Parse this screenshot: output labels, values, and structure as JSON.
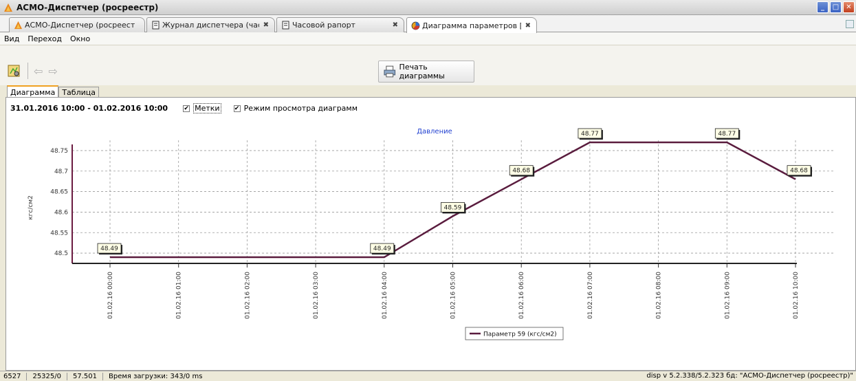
{
  "window": {
    "title": "АСМО-Диспетчер (росреестр)",
    "buttons": {
      "minimize": "_",
      "maximize": "□",
      "close": "✕"
    }
  },
  "tabs": [
    {
      "label": "АСМО-Диспетчер (росреест",
      "icon": "app-logo-icon",
      "closable": false
    },
    {
      "label": "Журнал диспетчера (час",
      "icon": "document-icon",
      "close": "✖"
    },
    {
      "label": "Часовой рапорт",
      "icon": "document-icon",
      "close": "✖"
    },
    {
      "label": "Диаграмма параметров [",
      "icon": "pie-chart-icon",
      "close": "✖",
      "active": true
    }
  ],
  "menu": [
    "Вид",
    "Переход",
    "Окно"
  ],
  "toolbar": {
    "print_label": "Печать диаграммы"
  },
  "view_tabs": [
    "Диаграмма",
    "Таблица"
  ],
  "range": "31.01.2016 10:00 - 01.02.2016 10:00",
  "checkboxes": [
    {
      "label": "Метки",
      "checked": true
    },
    {
      "label": "Режим просмотра диаграмм",
      "checked": true
    }
  ],
  "chart_data": {
    "type": "line",
    "title": "Давление",
    "ylabel": "кгс/см2",
    "ylim": [
      48.475,
      48.775
    ],
    "yticks": [
      48.5,
      48.55,
      48.6,
      48.65,
      48.7,
      48.75
    ],
    "ytick_labels": [
      "48.5",
      "48.55",
      "48.6",
      "48.65",
      "48.7",
      "48.75"
    ],
    "categories": [
      "01.02.16 00:00",
      "01.02.16 01:00",
      "01.02.16 02:00",
      "01.02.16 03:00",
      "01.02.16 04:00",
      "01.02.16 05:00",
      "01.02.16 06:00",
      "01.02.16 07:00",
      "01.02.16 08:00",
      "01.02.16 09:00",
      "01.02.16 10:00"
    ],
    "series": [
      {
        "name": "Параметр 59 (кгс/см2)",
        "color": "#5a1c3e",
        "values": [
          48.49,
          48.49,
          48.49,
          48.49,
          48.49,
          48.59,
          48.68,
          48.77,
          48.77,
          48.77,
          48.68
        ],
        "labels": [
          {
            "index": 0,
            "text": "48.49"
          },
          {
            "index": 4,
            "text": "48.49"
          },
          {
            "index": 5,
            "text": "48.59"
          },
          {
            "index": 6,
            "text": "48.68"
          },
          {
            "index": 7,
            "text": "48.77"
          },
          {
            "index": 9,
            "text": "48.77"
          },
          {
            "index": 10,
            "text": "48.68"
          }
        ]
      }
    ],
    "grid": true,
    "legend": "bottom-center"
  },
  "status": {
    "items": [
      "6527",
      "25325/0",
      "57.501",
      "Время загрузки: 343/0 ms"
    ],
    "right": "disp  v 5.2.338/5.2.323  бд: \"АСМО-Диспетчер (росреестр)\""
  }
}
